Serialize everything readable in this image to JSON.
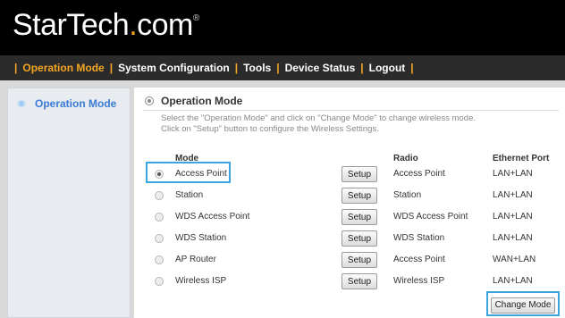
{
  "brand": {
    "logo_part1": "StarTech",
    "logo_dot": ".",
    "logo_part2": "com",
    "logo_tm": "®"
  },
  "nav": {
    "items": [
      {
        "label": "Operation Mode"
      },
      {
        "label": "System Configuration"
      },
      {
        "label": "Tools"
      },
      {
        "label": "Device Status"
      },
      {
        "label": "Logout"
      }
    ],
    "separator": "|"
  },
  "sidebar": {
    "items": [
      {
        "label": "Operation Mode"
      }
    ]
  },
  "main": {
    "title": "Operation Mode",
    "description_line1": "Select the \"Operation Mode\" and click on \"Change Mode\" to change wireless mode.",
    "description_line2": "Click on \"Setup\" button to configure the Wireless Settings.",
    "columns": {
      "mode": "Mode",
      "radio": "Radio",
      "ethernet": "Ethernet Port"
    },
    "rows": [
      {
        "mode": "Access Point",
        "setup": "Setup",
        "radio": "Access Point",
        "ethernet": "LAN+LAN",
        "selected": true
      },
      {
        "mode": "Station",
        "setup": "Setup",
        "radio": "Station",
        "ethernet": "LAN+LAN",
        "selected": false
      },
      {
        "mode": "WDS Access Point",
        "setup": "Setup",
        "radio": "WDS Access Point",
        "ethernet": "LAN+LAN",
        "selected": false
      },
      {
        "mode": "WDS Station",
        "setup": "Setup",
        "radio": "WDS Station",
        "ethernet": "LAN+LAN",
        "selected": false
      },
      {
        "mode": "AP Router",
        "setup": "Setup",
        "radio": "Access Point",
        "ethernet": "WAN+LAN",
        "selected": false
      },
      {
        "mode": "Wireless ISP",
        "setup": "Setup",
        "radio": "Wireless ISP",
        "ethernet": "LAN+LAN",
        "selected": false
      }
    ],
    "change_button": "Change Mode"
  },
  "colors": {
    "accent": "#f5a623",
    "link": "#3a7bd5",
    "highlight": "#3aa5e0"
  }
}
